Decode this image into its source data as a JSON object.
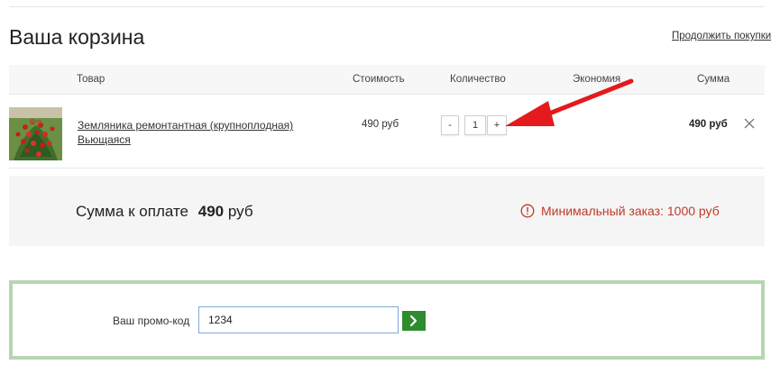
{
  "cart": {
    "title": "Ваша корзина",
    "continue_link": "Продолжить покупки"
  },
  "table": {
    "headers": {
      "product": "Товар",
      "cost": "Стоимость",
      "quantity": "Количество",
      "savings": "Экономия",
      "sum": "Сумма"
    },
    "rows": [
      {
        "name": "Земляника ремонтантная (крупноплодная) Вьющаяся",
        "price": "490 руб",
        "qty_minus": "-",
        "quantity": "1",
        "qty_plus": "+",
        "savings": "",
        "sum": "490 руб",
        "remove_icon": "close-icon",
        "thumbnail_icon": "strawberry-plant-image"
      }
    ]
  },
  "summary": {
    "label": "Сумма к оплате",
    "amount": "490",
    "currency": "руб",
    "min_order": "Минимальный заказ: 1000 руб",
    "warning_color": "#c0392b"
  },
  "promo": {
    "label": "Ваш промо-код",
    "value": "1234",
    "submit_icon": "chevron-right-icon",
    "border_color": "#b5d6b0",
    "button_color": "#2e8b2e"
  },
  "annotation": {
    "arrow_color": "#e41a1c"
  }
}
